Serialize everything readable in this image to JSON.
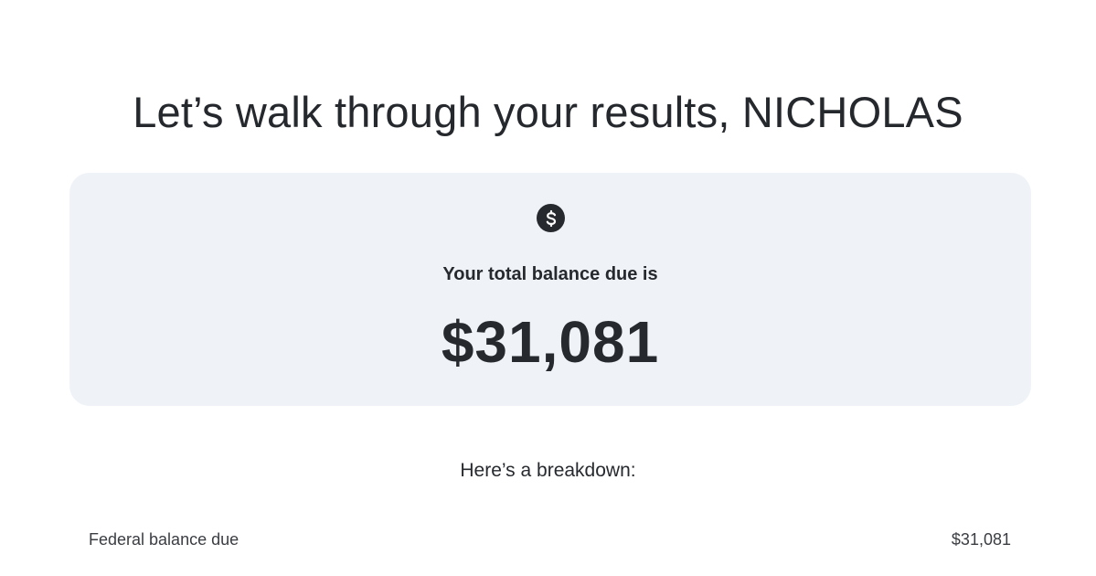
{
  "header": {
    "title": "Let’s walk through your results, NICHOLAS"
  },
  "summary": {
    "icon": "dollar-circle-icon",
    "label": "Your total balance due is",
    "amount": "$31,081"
  },
  "breakdown": {
    "heading": "Here’s a breakdown:",
    "rows": [
      {
        "label": "Federal balance due",
        "value": "$31,081"
      }
    ]
  },
  "colors": {
    "text": "#26292e",
    "card_background": "#eff3f7",
    "page_background": "#ffffff"
  }
}
